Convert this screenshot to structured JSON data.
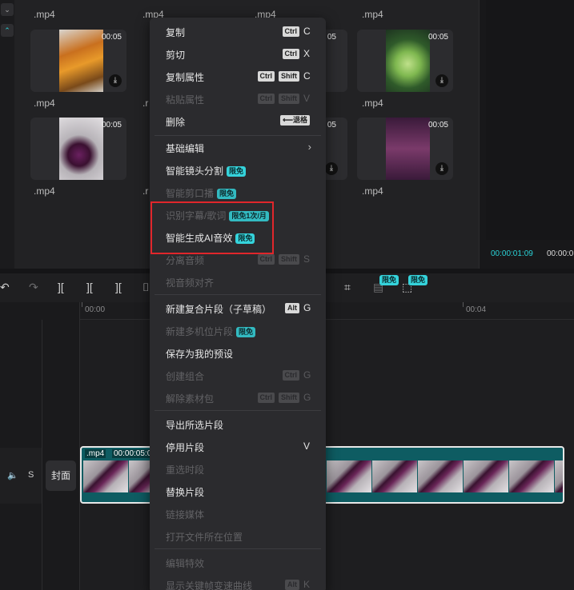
{
  "media": {
    "clips": [
      {
        "name": ".mp4",
        "duration": ""
      },
      {
        "name": ".mp4",
        "duration": ""
      },
      {
        "name": ".mp4",
        "duration": ""
      },
      {
        "name": ".mp4",
        "duration": ""
      },
      {
        "name": ".mp4",
        "duration": "00:05"
      },
      {
        "name": ".r",
        "duration": ""
      },
      {
        "name": "",
        "duration": "05"
      },
      {
        "name": ".mp4",
        "duration": "00:05"
      },
      {
        "name": ".mp4",
        "duration": "00:05"
      },
      {
        "name": ".r",
        "duration": ""
      },
      {
        "name": "",
        "duration": "05"
      },
      {
        "name": ".mp4",
        "duration": "00:05"
      }
    ]
  },
  "preview": {
    "current_time": "00:00:01:09",
    "total_time": "00:00:0"
  },
  "toolbar": {
    "badge_1": "限免",
    "badge_2": "限免"
  },
  "timeline": {
    "ruler_start": "00:00",
    "ruler_end": "00:04",
    "track_s": "S",
    "cover_label": "封面",
    "clip_name": ".mp4",
    "clip_duration": "00:00:05:0"
  },
  "menu": {
    "items": [
      {
        "label": "复制",
        "keys": [
          "Ctrl"
        ],
        "letter": "C",
        "disabled": false
      },
      {
        "label": "剪切",
        "keys": [
          "Ctrl"
        ],
        "letter": "X",
        "disabled": false
      },
      {
        "label": "复制属性",
        "keys": [
          "Ctrl",
          "Shift"
        ],
        "letter": "C",
        "disabled": false
      },
      {
        "label": "粘贴属性",
        "keys": [
          "Ctrl",
          "Shift"
        ],
        "letter": "V",
        "disabled": true
      },
      {
        "label": "删除",
        "keys": [
          "⟵退格"
        ],
        "letter": "",
        "disabled": false
      },
      {
        "label": "基础编辑",
        "submenu": true,
        "disabled": false
      },
      {
        "label": "智能镜头分割",
        "badge": "限免",
        "disabled": false
      },
      {
        "label": "智能剪口播",
        "badge": "限免",
        "disabled": true
      },
      {
        "label": "识别字幕/歌词",
        "badge": "限免1次/月",
        "disabled": true
      },
      {
        "label": "智能生成AI音效",
        "badge": "限免",
        "disabled": false
      },
      {
        "label": "分离音频",
        "keys": [
          "Ctrl",
          "Shift"
        ],
        "letter": "S",
        "disabled": true
      },
      {
        "label": "视音频对齐",
        "disabled": true
      },
      {
        "label": "新建复合片段（子草稿）",
        "keys": [
          "Alt"
        ],
        "letter": "G",
        "disabled": false
      },
      {
        "label": "新建多机位片段",
        "badge": "限免",
        "disabled": true
      },
      {
        "label": "保存为我的预设",
        "disabled": false
      },
      {
        "label": "创建组合",
        "keys": [
          "Ctrl"
        ],
        "letter": "G",
        "disabled": true
      },
      {
        "label": "解除素材包",
        "keys": [
          "Ctrl",
          "Shift"
        ],
        "letter": "G",
        "disabled": true
      },
      {
        "label": "导出所选片段",
        "disabled": false
      },
      {
        "label": "停用片段",
        "letter": "V",
        "disabled": false
      },
      {
        "label": "重选时段",
        "disabled": true
      },
      {
        "label": "替换片段",
        "disabled": false
      },
      {
        "label": "链接媒体",
        "disabled": true
      },
      {
        "label": "打开文件所在位置",
        "disabled": true
      },
      {
        "label": "编辑特效",
        "disabled": true
      },
      {
        "label": "显示关键帧变速曲线",
        "keys": [
          "Alt"
        ],
        "letter": "K",
        "disabled": true
      }
    ]
  }
}
